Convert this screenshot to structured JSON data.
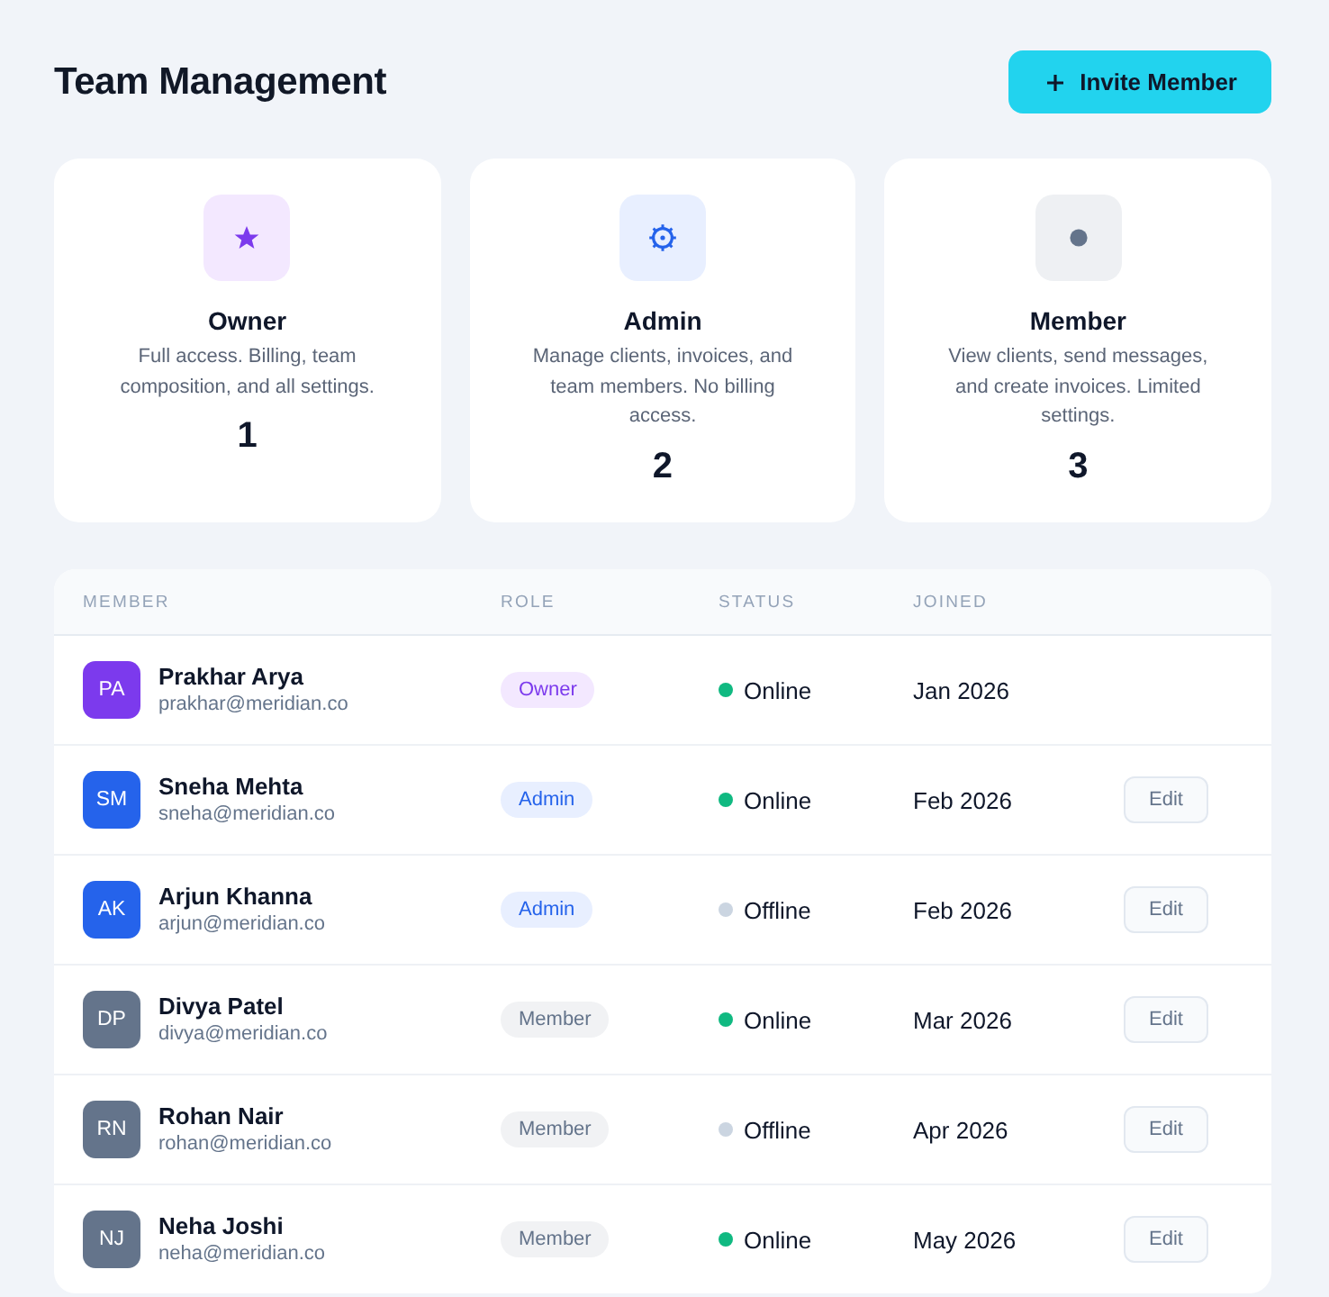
{
  "header": {
    "title": "Team Management",
    "invite_button": "Invite Member"
  },
  "role_cards": [
    {
      "kind": "owner",
      "title": "Owner",
      "description": "Full access. Billing, team composition, and all settings.",
      "count": "1"
    },
    {
      "kind": "admin",
      "title": "Admin",
      "description": "Manage clients, invoices, and team members. No billing access.",
      "count": "2"
    },
    {
      "kind": "member",
      "title": "Member",
      "description": "View clients, send messages, and create invoices. Limited settings.",
      "count": "3"
    }
  ],
  "table": {
    "columns": [
      "MEMBER",
      "ROLE",
      "STATUS",
      "JOINED"
    ],
    "rows": [
      {
        "initials": "PA",
        "name": "Prakhar Arya",
        "email": "prakhar@meridian.co",
        "role": {
          "label": "Owner",
          "kind": "owner"
        },
        "status": {
          "label": "Online",
          "online": true
        },
        "joined": "Jan 2026"
      },
      {
        "initials": "SM",
        "name": "Sneha Mehta",
        "email": "sneha@meridian.co",
        "role": {
          "label": "Admin",
          "kind": "admin"
        },
        "status": {
          "label": "Online",
          "online": true
        },
        "joined": "Feb 2026",
        "action": "Edit"
      },
      {
        "initials": "AK",
        "name": "Arjun Khanna",
        "email": "arjun@meridian.co",
        "role": {
          "label": "Admin",
          "kind": "admin"
        },
        "status": {
          "label": "Offline",
          "online": false
        },
        "joined": "Feb 2026",
        "action": "Edit"
      },
      {
        "initials": "DP",
        "name": "Divya Patel",
        "email": "divya@meridian.co",
        "role": {
          "label": "Member",
          "kind": "member"
        },
        "status": {
          "label": "Online",
          "online": true
        },
        "joined": "Mar 2026",
        "action": "Edit"
      },
      {
        "initials": "RN",
        "name": "Rohan Nair",
        "email": "rohan@meridian.co",
        "role": {
          "label": "Member",
          "kind": "member"
        },
        "status": {
          "label": "Offline",
          "online": false
        },
        "joined": "Apr 2026",
        "action": "Edit"
      },
      {
        "initials": "NJ",
        "name": "Neha Joshi",
        "email": "neha@meridian.co",
        "role": {
          "label": "Member",
          "kind": "member"
        },
        "status": {
          "label": "Online",
          "online": true
        },
        "joined": "May 2026",
        "action": "Edit"
      }
    ]
  }
}
